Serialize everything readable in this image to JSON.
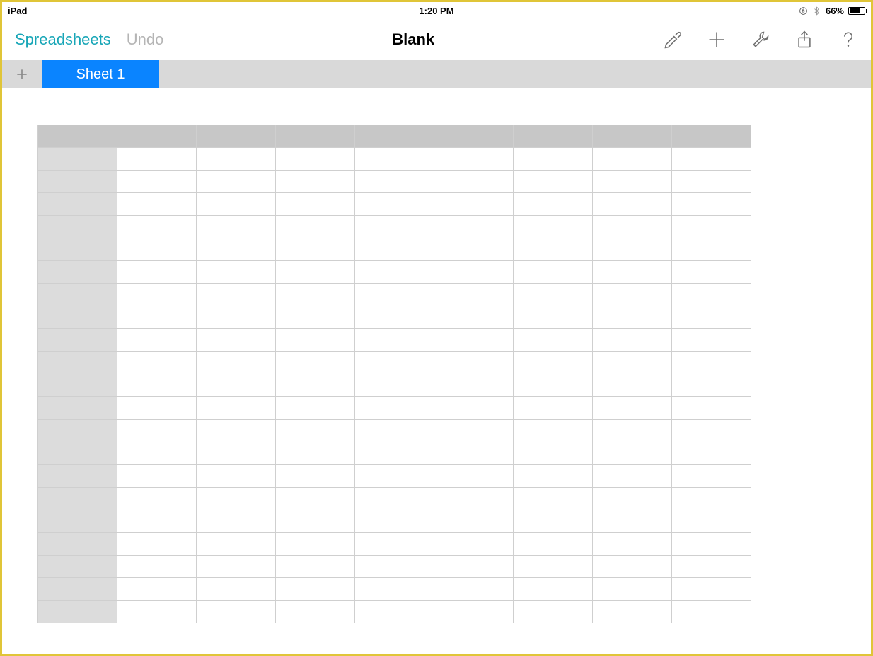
{
  "status_bar": {
    "device_label": "iPad",
    "time": "1:20 PM",
    "battery_percent": "66%"
  },
  "toolbar": {
    "back_label": "Spreadsheets",
    "undo_label": "Undo",
    "document_title": "Blank"
  },
  "tabs": {
    "active_sheet_label": "Sheet 1"
  },
  "grid": {
    "column_count": 8,
    "row_count": 21
  }
}
